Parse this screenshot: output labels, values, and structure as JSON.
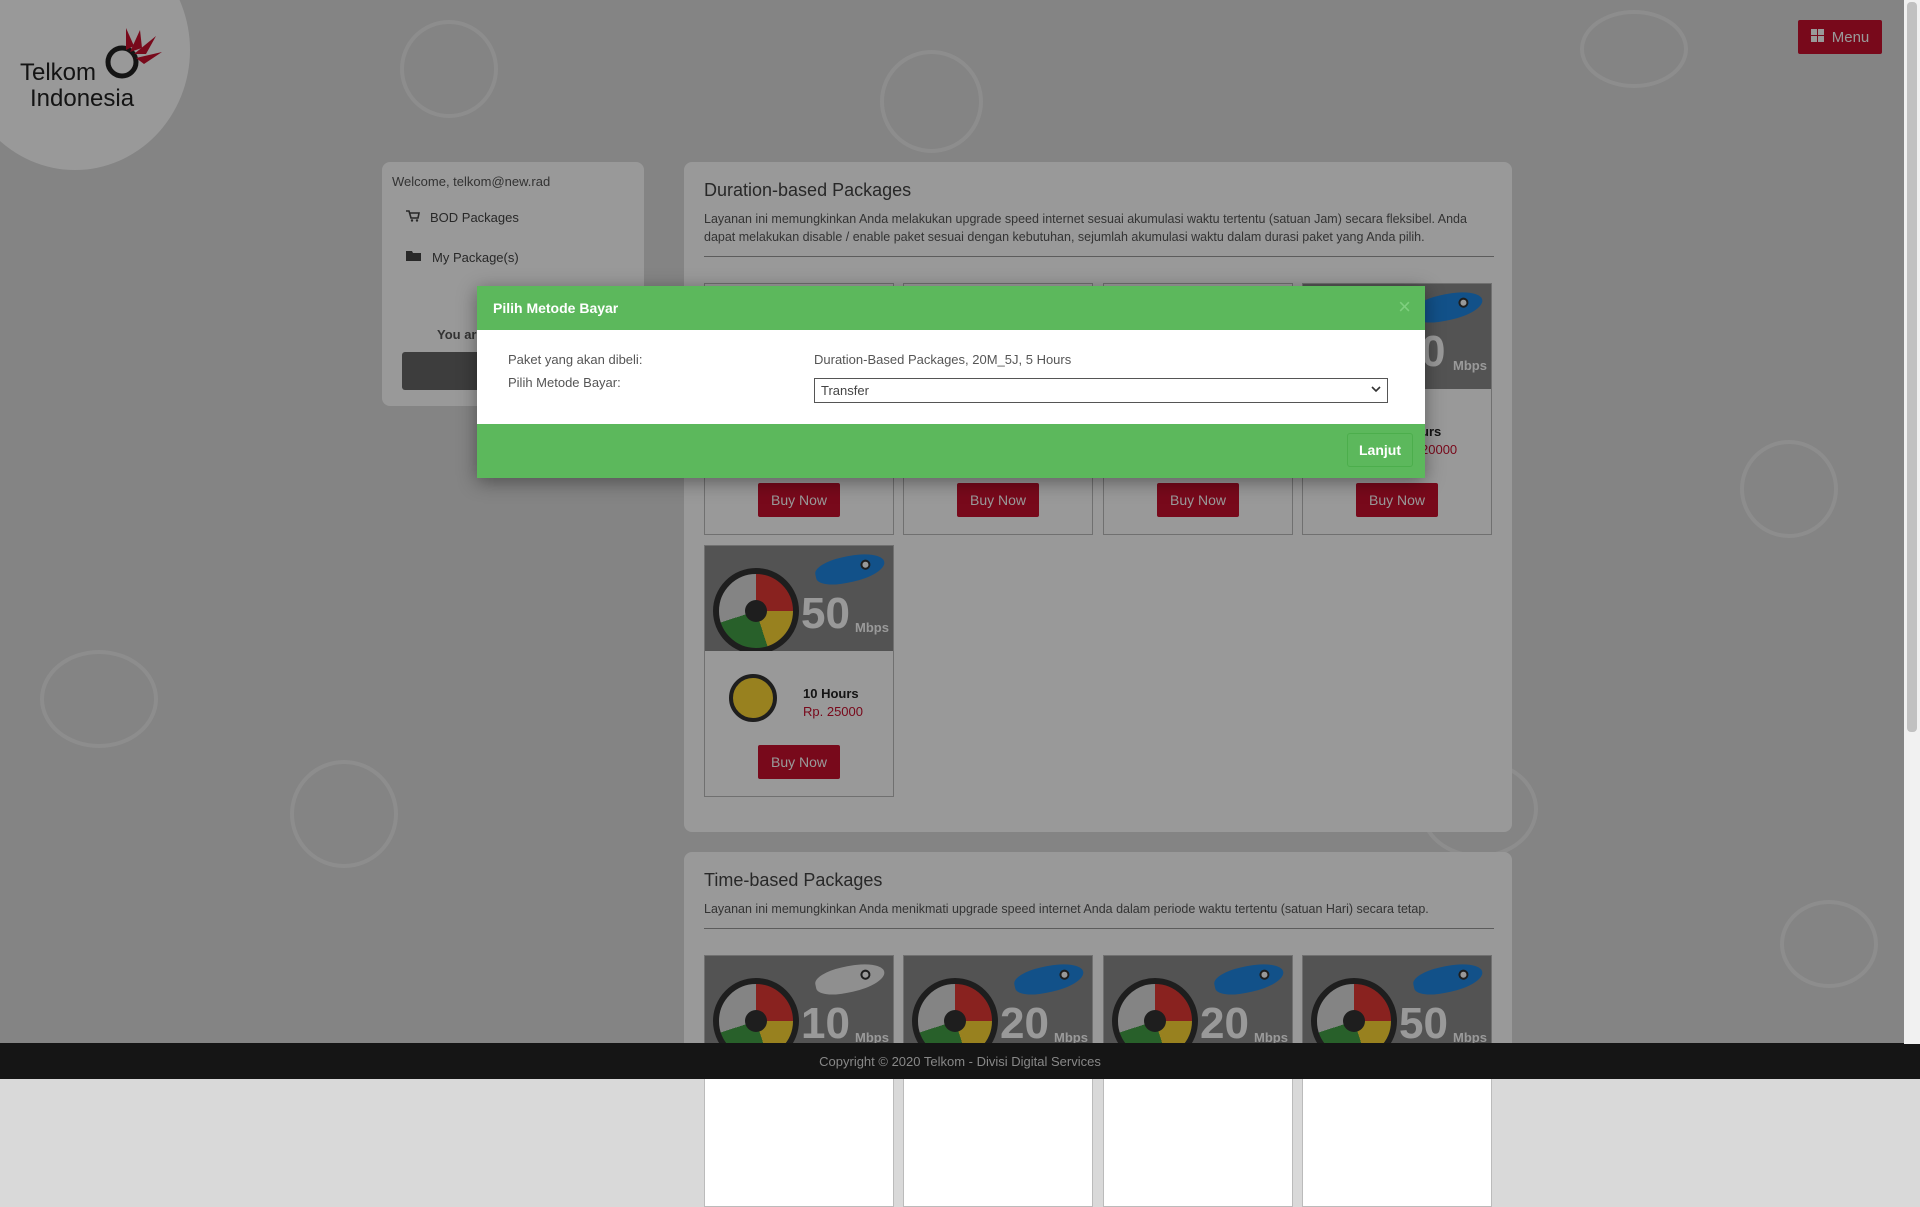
{
  "brand": {
    "line1": "Telkom",
    "line2": "Indonesia"
  },
  "header": {
    "menu_label": "Menu",
    "menu_icon": "grid-icon"
  },
  "sidebar": {
    "welcome": "Welcome, telkom@new.rad",
    "items": [
      {
        "label": "BOD Packages",
        "icon": "cart-icon"
      },
      {
        "label": "My Package(s)",
        "icon": "folder-icon"
      }
    ],
    "partial_text": "You ar"
  },
  "duration_section": {
    "title": "Duration-based Packages",
    "description": "Layanan ini memungkinkan Anda melakukan upgrade speed internet sesuai akumulasi waktu tertentu (satuan Jam) secara fleksibel. Anda dapat melakukan disable / enable paket sesuai dengan kebutuhan, sejumlah akumulasi waktu dalam durasi paket yang Anda pilih.",
    "partial_card": {
      "speed": "0",
      "unit": "Mbps",
      "duration": "urs",
      "price": "20000"
    },
    "cards": [
      {
        "buy_label": "Buy Now"
      },
      {
        "buy_label": "Buy Now"
      },
      {
        "buy_label": "Buy Now"
      },
      {
        "buy_label": "Buy Now"
      },
      {
        "speed": "50",
        "unit": "Mbps",
        "duration": "10 Hours",
        "price": "Rp. 25000",
        "buy_label": "Buy Now"
      }
    ]
  },
  "time_section": {
    "title": "Time-based Packages",
    "description": "Layanan ini memungkinkan Anda menikmati upgrade speed internet Anda dalam periode waktu tertentu (satuan Hari) secara tetap.",
    "cards": [
      {
        "speed": "10",
        "unit": "Mbps"
      },
      {
        "speed": "20",
        "unit": "Mbps"
      },
      {
        "speed": "20",
        "unit": "Mbps"
      },
      {
        "speed": "50",
        "unit": "Mbps"
      }
    ]
  },
  "modal": {
    "title": "Pilih Metode Bayar",
    "close": "×",
    "package_label": "Paket yang akan dibeli:",
    "package_value": "Duration-Based Packages, 20M_5J, 5 Hours",
    "method_label": "Pilih Metode Bayar:",
    "method_selected": "Transfer",
    "submit_label": "Lanjut"
  },
  "footer": {
    "copyright": "Copyright © 2020 Telkom - Divisi Digital Services"
  },
  "colors": {
    "brand_red": "#c8102e",
    "modal_green": "#5cb85c"
  }
}
